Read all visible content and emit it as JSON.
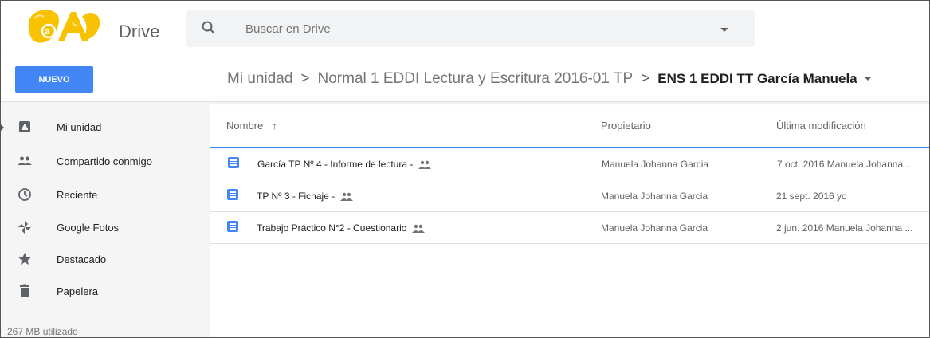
{
  "app": {
    "brand": "Drive"
  },
  "search": {
    "placeholder": "Buscar en Drive"
  },
  "toolbar": {
    "new_label": "NUEVO"
  },
  "breadcrumb": {
    "root": "Mi unidad",
    "middle": "Normal 1 EDDI Lectura y Escritura 2016-01 TP",
    "current": "ENS 1 EDDI TT García Manuela",
    "separator": ">"
  },
  "sidebar": {
    "items": [
      {
        "label": "Mi unidad",
        "icon": "drive-icon"
      },
      {
        "label": "Compartido conmigo",
        "icon": "people-icon"
      },
      {
        "label": "Reciente",
        "icon": "clock-icon"
      },
      {
        "label": "Google Fotos",
        "icon": "pinwheel-icon"
      },
      {
        "label": "Destacado",
        "icon": "star-icon"
      },
      {
        "label": "Papelera",
        "icon": "trash-icon"
      }
    ],
    "storage": "267 MB utilizado"
  },
  "table": {
    "columns": {
      "name": "Nombre",
      "owner": "Propietario",
      "modified": "Última modificación"
    },
    "sort_arrow": "↑",
    "rows": [
      {
        "name": "García TP Nº 4 - Informe de lectura -",
        "owner": "Manuela Johanna Garcia",
        "modified": "7 oct. 2016 Manuela Johanna ...",
        "shared": true
      },
      {
        "name": "TP Nº 3 - Fichaje -",
        "owner": "Manuela Johanna Garcia",
        "modified": "21 sept. 2016 yo",
        "shared": true
      },
      {
        "name": "Trabajo Práctico N°2 - Cuestionario",
        "owner": "Manuela Johanna Garcia",
        "modified": "2 jun. 2016 Manuela Johanna ...",
        "shared": true
      }
    ]
  },
  "colors": {
    "accent": "#4285f4",
    "sidebar_bg": "#f5f5f5",
    "logo_yellow": "#f8c200"
  }
}
